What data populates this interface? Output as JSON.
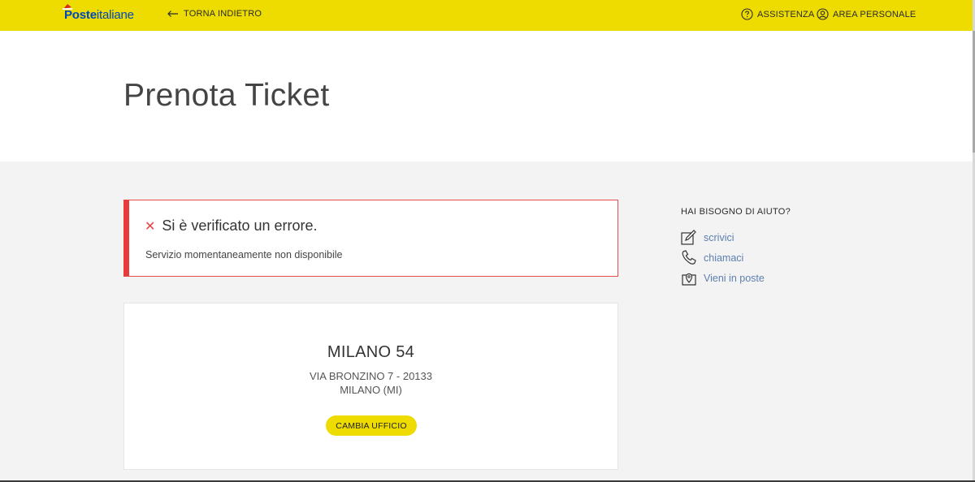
{
  "header": {
    "logo_bold": "Poste",
    "logo_thin": "italiane",
    "back_label": "TORNA INDIETRO",
    "assistance_label": "ASSISTENZA",
    "personal_area_label": "AREA PERSONALE",
    "accent_color": "#eedc00"
  },
  "page": {
    "title": "Prenota Ticket"
  },
  "error": {
    "title": "Si è verificato un errore.",
    "message": "Servizio momentaneamente non disponibile",
    "color": "#e83c3c"
  },
  "office": {
    "name": "MILANO 54",
    "address_line1": "VIA BRONZINO 7 - 20133",
    "address_line2": "MILANO (MI)",
    "change_button_label": "CAMBIA UFFICIO"
  },
  "help": {
    "title": "HAI BISOGNO DI AIUTO?",
    "items": [
      {
        "label": "scrivici",
        "icon": "pencil-icon"
      },
      {
        "label": "chiamaci",
        "icon": "phone-icon"
      },
      {
        "label": "Vieni in poste",
        "icon": "location-icon"
      }
    ],
    "link_color": "#5c7fb0"
  }
}
